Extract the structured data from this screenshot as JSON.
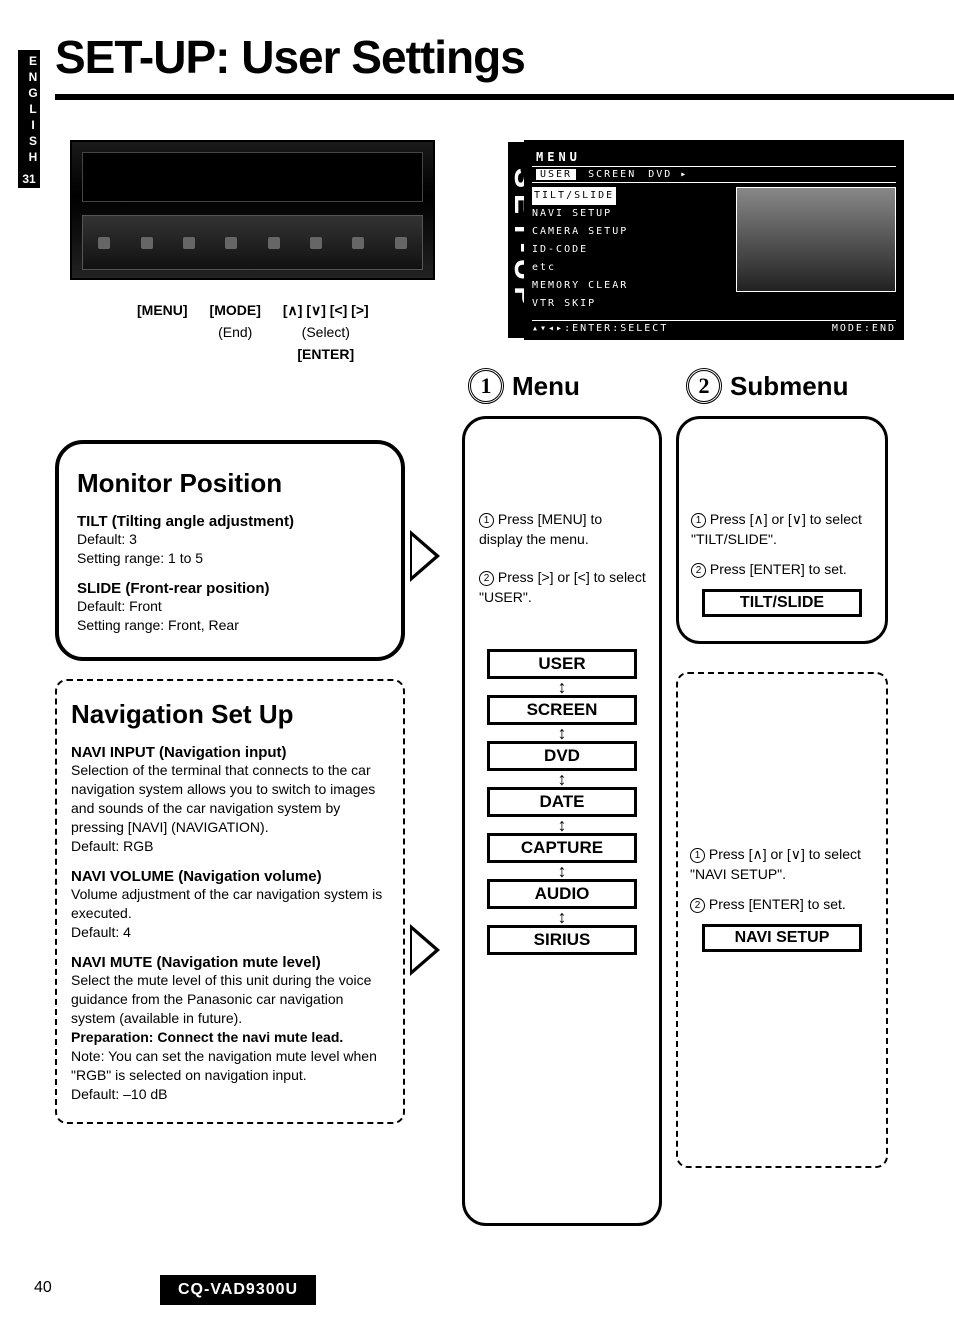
{
  "lang_tab": "ENGLISH",
  "lang_page": "31",
  "title": "SET-UP: User Settings",
  "button_labels": {
    "row1": [
      "[MENU]",
      "[MODE]",
      "[∧] [∨] [<] [>]"
    ],
    "row2": [
      "",
      "(End)",
      "(Select)"
    ],
    "row3": [
      "",
      "",
      "[ENTER]"
    ]
  },
  "menu_screenshot": {
    "title": "MENU",
    "tabs": [
      "USER",
      "SCREEN",
      "DVD ▸"
    ],
    "selected_tab": "USER",
    "highlight": "TILT/SLIDE",
    "items": [
      "NAVI SETUP",
      "CAMERA SETUP",
      "ID-CODE",
      "etc",
      "MEMORY CLEAR",
      "VTR SKIP"
    ],
    "footer_left": "▴▾◂▸:ENTER:SELECT",
    "footer_right": "MODE:END",
    "side_label": "SET-UP"
  },
  "steps": {
    "menu_num": "1",
    "menu_label": "Menu",
    "submenu_num": "2",
    "submenu_label": "Submenu"
  },
  "monitor_position": {
    "heading": "Monitor Position",
    "tilt_h": "TILT (Tilting angle adjustment)",
    "tilt_default": "Default: 3",
    "tilt_range": "Setting range: 1 to 5",
    "slide_h": "SLIDE (Front-rear position)",
    "slide_default": "Default: Front",
    "slide_range": "Setting range: Front, Rear"
  },
  "navigation": {
    "heading": "Navigation Set Up",
    "input_h": "NAVI INPUT (Navigation input)",
    "input_p": "Selection of the terminal that connects to the car navigation system allows you to switch to images and sounds of the car navigation system by pressing [NAVI] (NAVIGATION).",
    "input_default": "Default: RGB",
    "vol_h": "NAVI VOLUME (Navigation volume)",
    "vol_p": "Volume adjustment of the car navigation system is executed.",
    "vol_default": "Default: 4",
    "mute_h": "NAVI MUTE (Navigation mute level)",
    "mute_p": "Select the mute level of this unit during the voice guidance from the Panasonic car navigation system (available in future).",
    "mute_prep": "Preparation: Connect the navi mute lead.",
    "mute_note": "Note: You can set the navigation mute level when \"RGB\" is selected on navigation input.",
    "mute_default": "Default: –10 dB"
  },
  "menu_col": {
    "instr1a": "Press [MENU] to display the menu.",
    "instr2a": "Press [>] or [<] to select \"USER\".",
    "items": [
      "USER",
      "SCREEN",
      "DVD",
      "DATE",
      "CAPTURE",
      "AUDIO",
      "SIRIUS"
    ]
  },
  "sub_col": {
    "box1": {
      "instr1": "Press [∧] or [∨] to select \"TILT/SLIDE\".",
      "instr2": "Press [ENTER] to set.",
      "item": "TILT/SLIDE"
    },
    "box2": {
      "instr1": "Press [∧] or [∨] to select \"NAVI SETUP\".",
      "instr2": "Press [ENTER] to set.",
      "item": "NAVI SETUP"
    }
  },
  "page_number": "40",
  "model": "CQ-VAD9300U"
}
